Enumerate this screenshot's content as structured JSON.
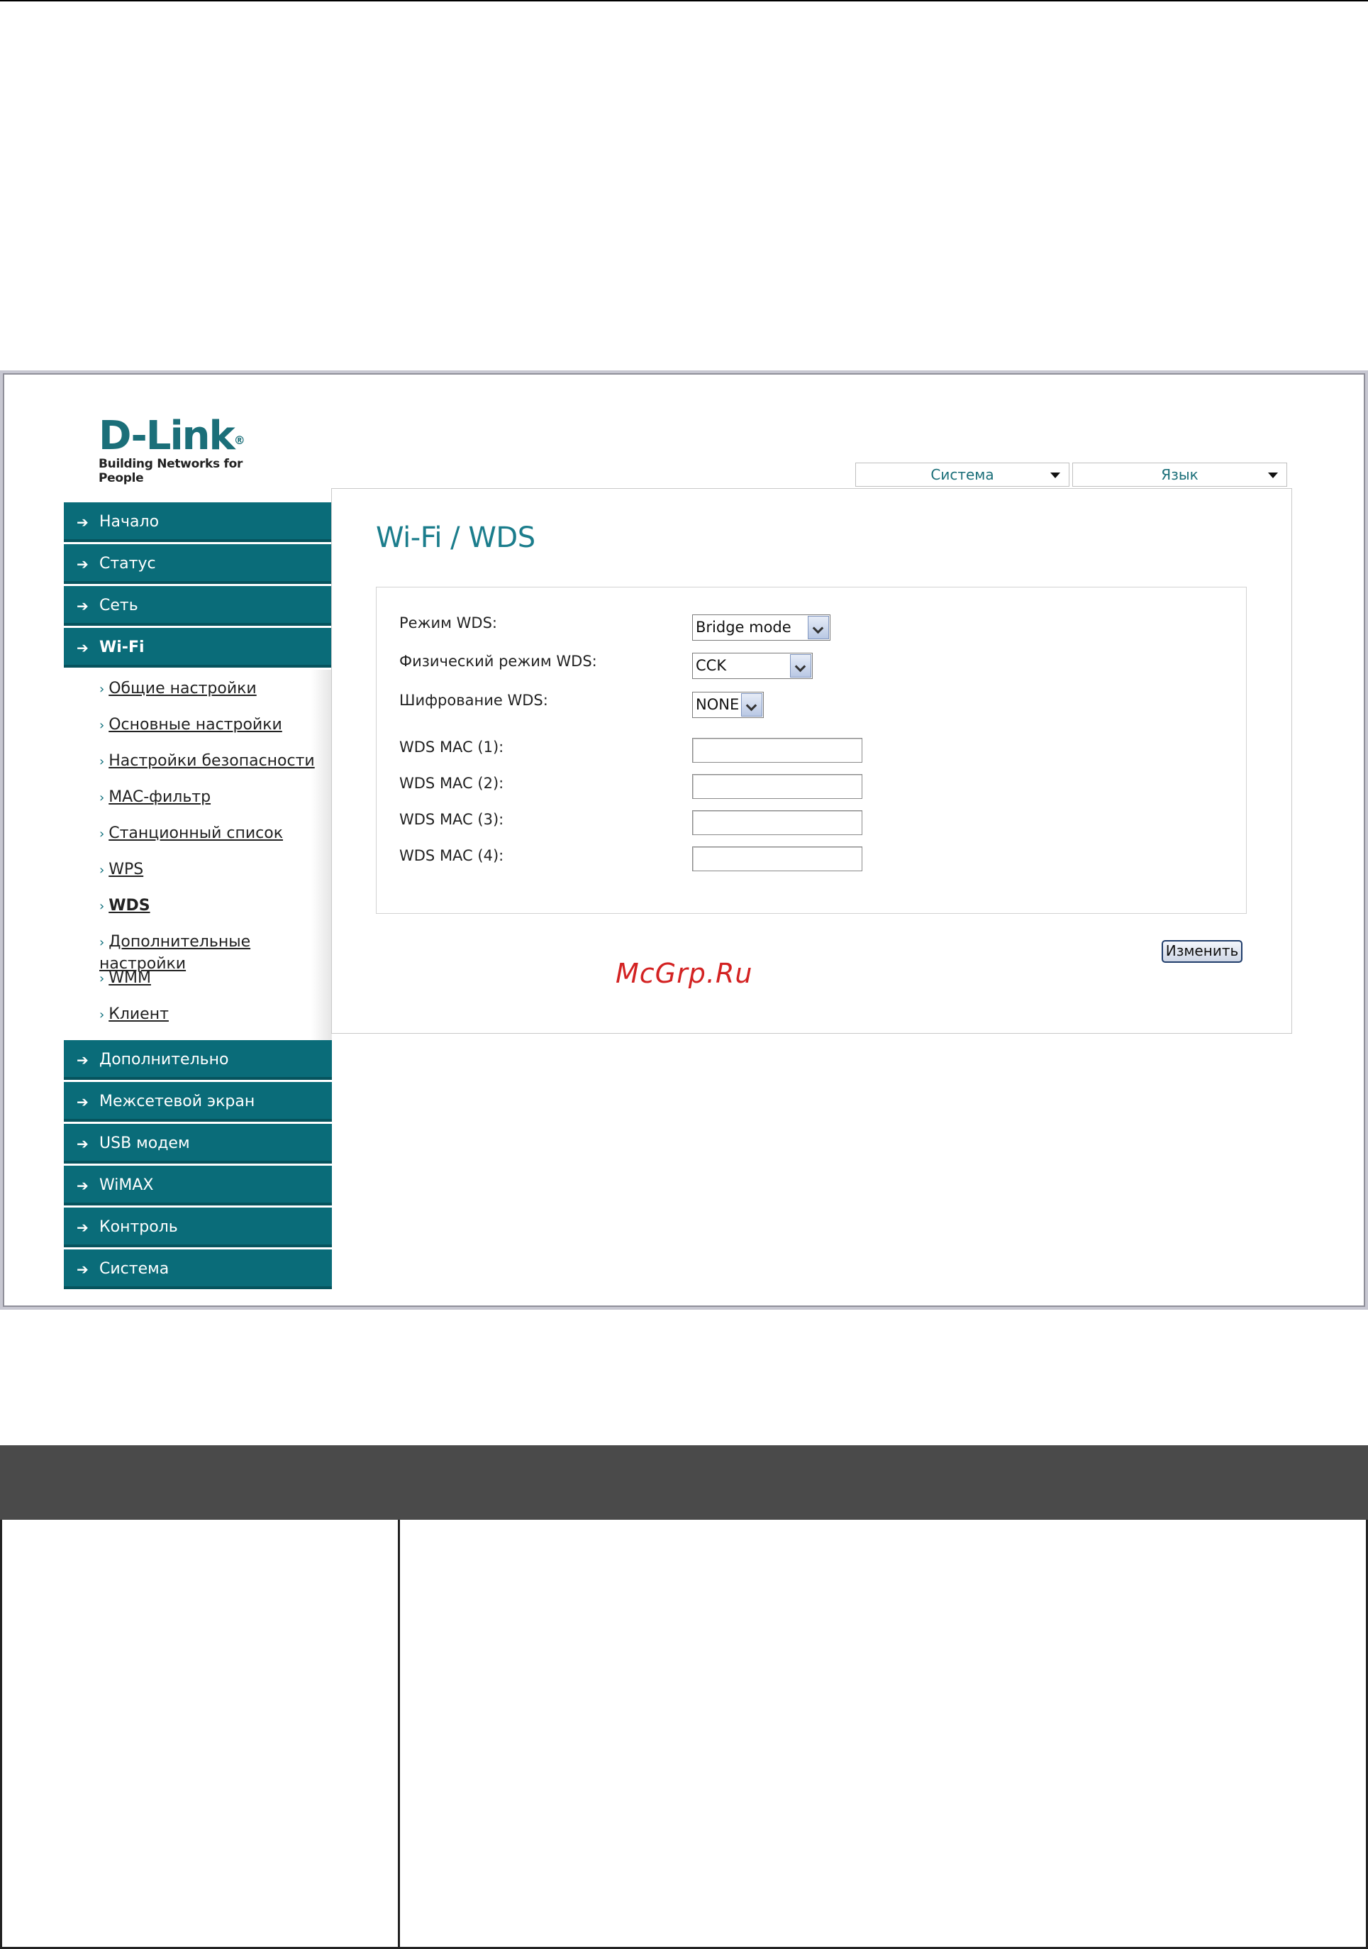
{
  "header": {
    "logo_brand": "D-Link",
    "logo_tagline": "Building Networks for People",
    "system_menu": "Система",
    "language_menu": "Язык"
  },
  "sidebar": {
    "items": [
      {
        "label": "Начало"
      },
      {
        "label": "Статус"
      },
      {
        "label": "Сеть"
      },
      {
        "label": "Wi-Fi"
      },
      {
        "label": "Дополнительно"
      },
      {
        "label": "Межсетевой экран"
      },
      {
        "label": "USB модем"
      },
      {
        "label": "WiMAX"
      },
      {
        "label": "Контроль"
      },
      {
        "label": "Система"
      }
    ],
    "wifi_subitems": [
      {
        "label": "Общие настройки"
      },
      {
        "label": "Основные настройки"
      },
      {
        "label": "Настройки безопасности"
      },
      {
        "label": "MAC-фильтр"
      },
      {
        "label": "Станционный список"
      },
      {
        "label": "WPS"
      },
      {
        "label": "WDS"
      },
      {
        "label": "Дополнительные настройки"
      },
      {
        "label": "WMM"
      },
      {
        "label": "Клиент"
      }
    ]
  },
  "main": {
    "title": "Wi-Fi  / WDS",
    "form": {
      "wds_mode_label": "Режим WDS:",
      "wds_mode_value": "Bridge mode",
      "phy_mode_label": "Физический режим WDS:",
      "phy_mode_value": "CCK",
      "encryption_label": "Шифрование WDS:",
      "encryption_value": "NONE",
      "mac1_label": "WDS MAC (1):",
      "mac1_value": "",
      "mac2_label": "WDS MAC (2):",
      "mac2_value": "",
      "mac3_label": "WDS MAC (3):",
      "mac3_value": "",
      "mac4_label": "WDS MAC (4):",
      "mac4_value": ""
    },
    "save_label": "Изменить"
  },
  "watermark": "McGrp.Ru",
  "colors": {
    "nav_bg": "#0a6c79",
    "title": "#1b7d8c",
    "watermark": "#d32222",
    "table_header": "#4a4a4a"
  }
}
